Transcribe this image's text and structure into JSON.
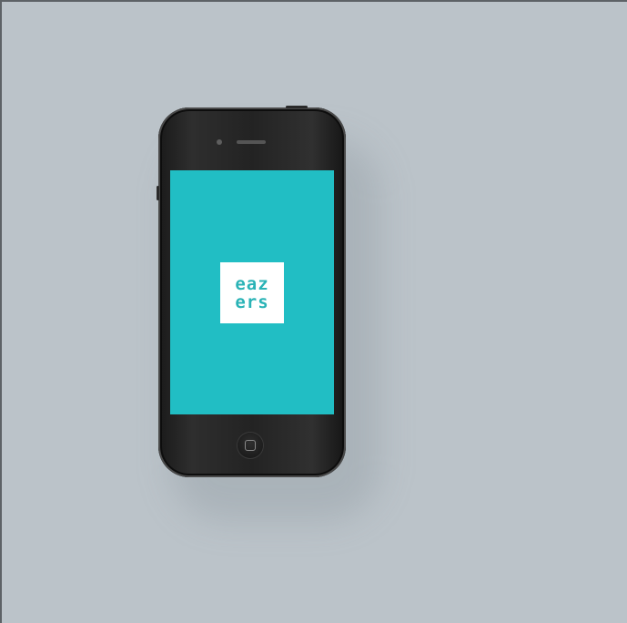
{
  "scene": {
    "background_color": "#bbc3c9",
    "border_color": "#5d6266"
  },
  "phone": {
    "body_color": "#1e1e1e",
    "screen_color": "#21bec4",
    "app": {
      "logo_line1": "eaz",
      "logo_line2": "ers",
      "logo_color": "#2ab3b6",
      "logo_background": "#ffffff"
    },
    "icons": {
      "camera": "front-camera-icon",
      "speaker": "earpiece-speaker-icon",
      "home": "home-button-icon"
    }
  }
}
